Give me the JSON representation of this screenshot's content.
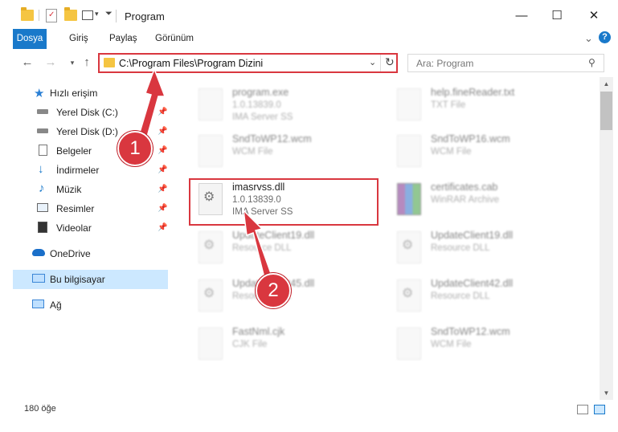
{
  "window": {
    "title": "Program",
    "minimize": "—",
    "maximize": "☐",
    "close": "✕"
  },
  "ribbon": {
    "tabs": [
      "Dosya",
      "Giriş",
      "Paylaş",
      "Görünüm"
    ],
    "expand": "⌄",
    "help": "?"
  },
  "address": {
    "path": "C:\\Program Files\\Program Dizini",
    "search_placeholder": "Ara: Program"
  },
  "nav": {
    "quick_access": "Hızlı erişim",
    "items": [
      {
        "label": "Yerel Disk (C:)",
        "icon": "drive-icon"
      },
      {
        "label": "Yerel Disk (D:)",
        "icon": "drive-icon"
      },
      {
        "label": "Belgeler",
        "icon": "documents-icon"
      },
      {
        "label": "İndirmeler",
        "icon": "download-icon"
      },
      {
        "label": "Müzik",
        "icon": "music-icon"
      },
      {
        "label": "Resimler",
        "icon": "pictures-icon"
      },
      {
        "label": "Videolar",
        "icon": "video-icon"
      }
    ],
    "onedrive": "OneDrive",
    "this_pc": "Bu bilgisayar",
    "network": "Ağ"
  },
  "files": [
    {
      "name": "program.exe",
      "line1": "1.0.13839.0",
      "line2": "IMA Server SS",
      "col": 0,
      "row": 0,
      "blur": true
    },
    {
      "name": "help.fineReader.txt",
      "line1": "TXT File",
      "line2": "",
      "col": 1,
      "row": 0,
      "blur": true
    },
    {
      "name": "SndToWP12.wcm",
      "line1": "WCM File",
      "line2": "",
      "col": 0,
      "row": 1,
      "blur": true
    },
    {
      "name": "SndToWP16.wcm",
      "line1": "WCM File",
      "line2": "",
      "col": 1,
      "row": 1,
      "blur": true
    },
    {
      "name": "imasrvss.dll",
      "line1": "1.0.13839.0",
      "line2": "IMA Server SS",
      "col": 0,
      "row": 2,
      "blur": false
    },
    {
      "name": "certificates.cab",
      "line1": "WinRAR Archive",
      "line2": "",
      "col": 1,
      "row": 2,
      "blur": true
    },
    {
      "name": "UpdateClient19.dll",
      "line1": "Resource DLL",
      "line2": "",
      "col": 0,
      "row": 3,
      "blur": true
    },
    {
      "name": "UpdateClient19.dll",
      "line1": "Resource DLL",
      "line2": "",
      "col": 1,
      "row": 3,
      "blur": true
    },
    {
      "name": "UpdateClient45.dll",
      "line1": "Resource DLL",
      "line2": "",
      "col": 0,
      "row": 4,
      "blur": true
    },
    {
      "name": "UpdateClient42.dll",
      "line1": "Resource DLL",
      "line2": "",
      "col": 1,
      "row": 4,
      "blur": true
    },
    {
      "name": "FastNml.cjk",
      "line1": "CJK File",
      "line2": "",
      "col": 0,
      "row": 5,
      "blur": true
    },
    {
      "name": "SndToWP12.wcm",
      "line1": "WCM File",
      "line2": "",
      "col": 1,
      "row": 5,
      "blur": true
    }
  ],
  "status": {
    "count": "180 öğe"
  },
  "annotations": {
    "step1": "1",
    "step2": "2"
  },
  "colors": {
    "accent": "#1979ca",
    "annotation": "#d9373f",
    "selection": "#cce8ff"
  }
}
